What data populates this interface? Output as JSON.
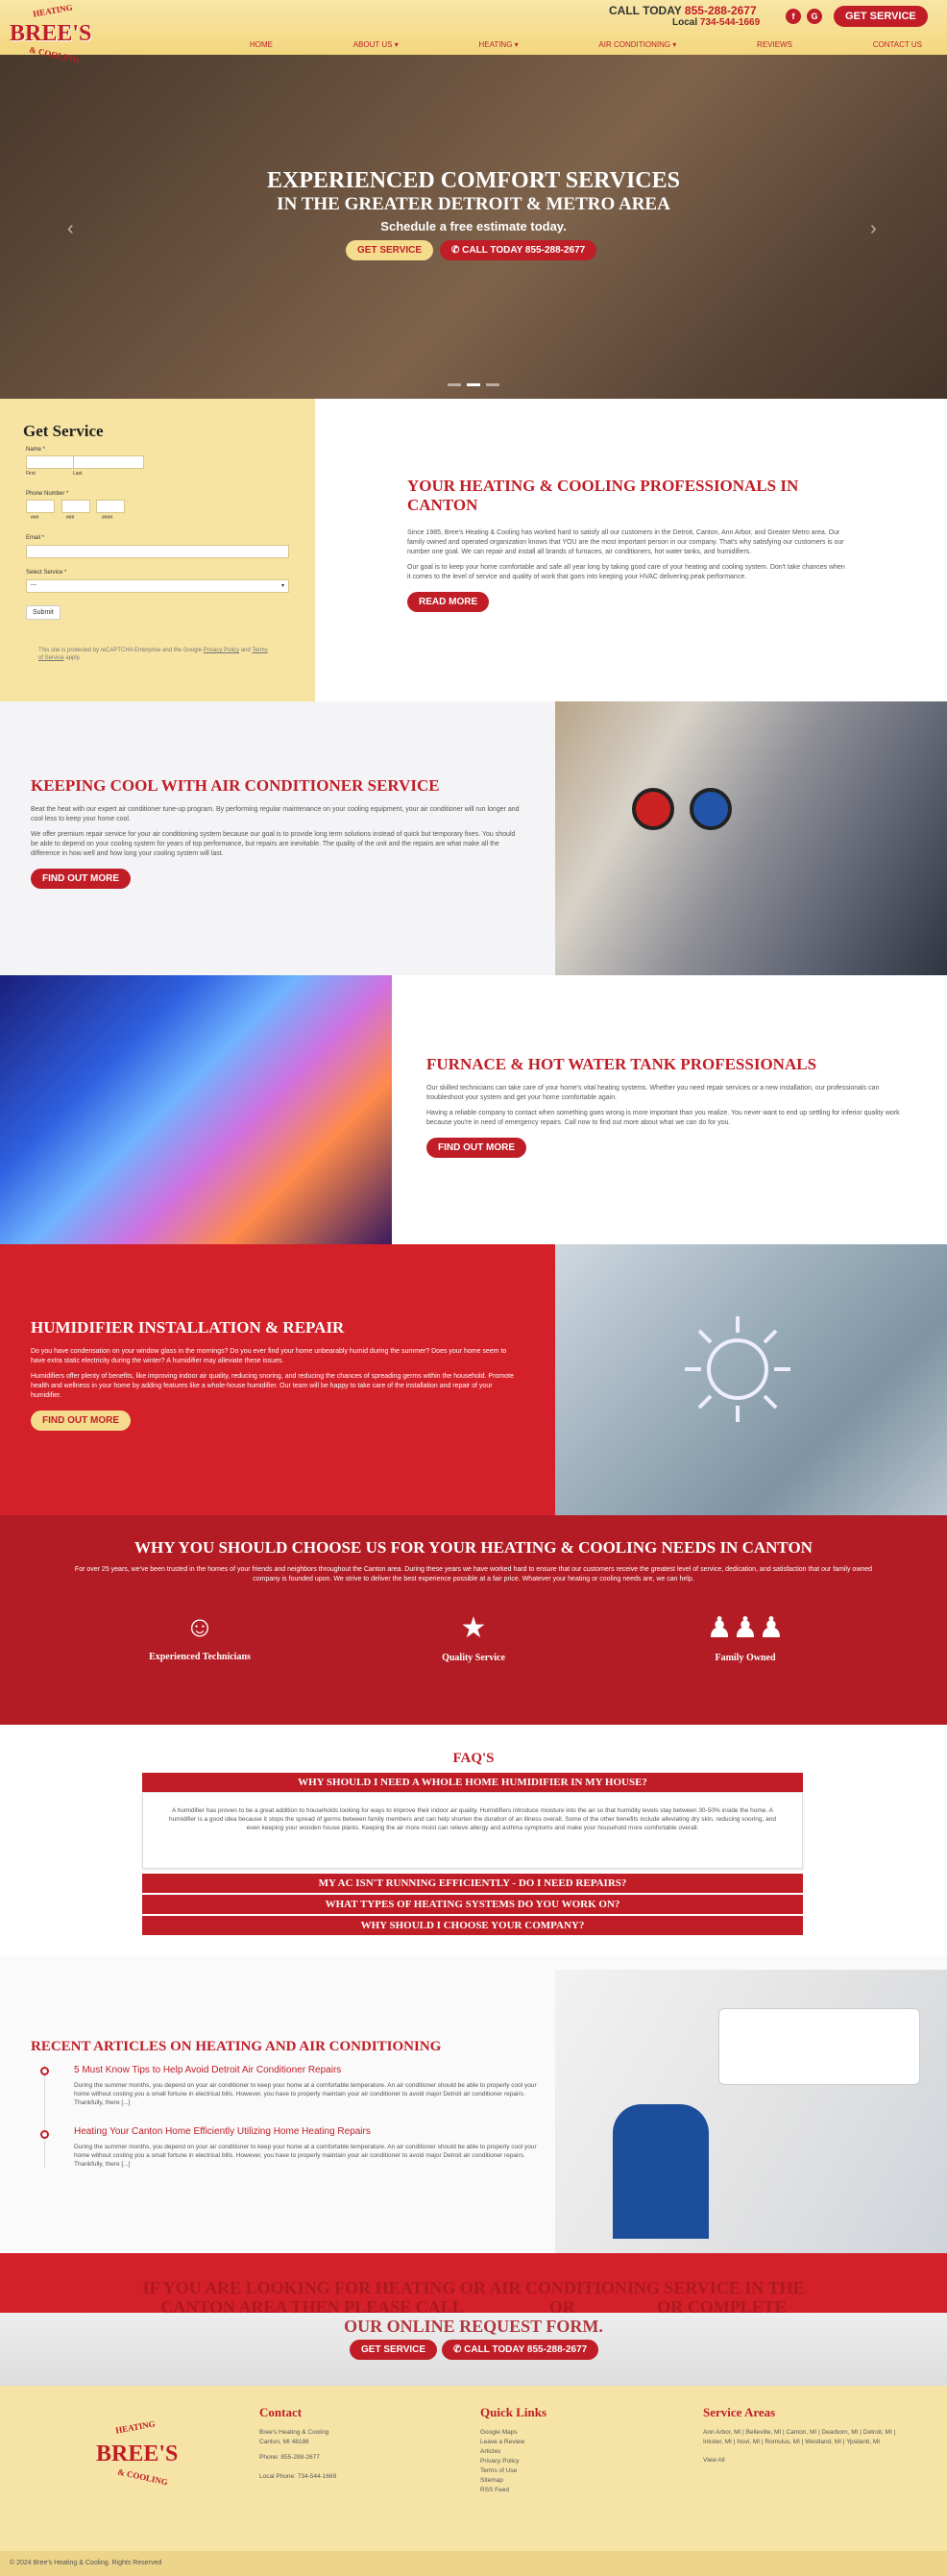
{
  "header": {
    "logo_top": "HEATING",
    "logo_main": "BREE'S",
    "logo_bottom": "& COOLING",
    "phone_label": "CALL TODAY",
    "phone_number": "855-288-2677",
    "local_label": "Local",
    "local_number": "734-544-1669",
    "social": [
      "f",
      "G"
    ],
    "cta": "GET SERVICE",
    "nav": [
      "HOME",
      "ABOUT US ▾",
      "HEATING ▾",
      "AIR CONDITIONING ▾",
      "REVIEWS",
      "CONTACT US"
    ]
  },
  "hero": {
    "line1": "EXPERIENCED COMFORT SERVICES",
    "line2": "IN THE GREATER DETROIT & METRO AREA",
    "sub": "Schedule a free estimate today.",
    "btn1": "GET SERVICE",
    "btn2": "CALL TODAY 855-288-2677",
    "prev": "‹",
    "next": "›"
  },
  "form": {
    "title": "Get Service",
    "name_label": "Name *",
    "first": "First",
    "last": "Last",
    "phone_label": "Phone Number *",
    "p1": "###",
    "p2": "###",
    "p3": "####",
    "email_label": "Email *",
    "select_label": "Select Service *",
    "select_value": "---",
    "submit": "Submit",
    "recaptcha1": "This site is protected by reCAPTCHA Enterprise and the Google",
    "privacy": "Privacy Policy",
    "and": "and",
    "terms": "Terms of Service",
    "apply": "apply."
  },
  "intro": {
    "title": "YOUR HEATING & COOLING PROFESSIONALS IN CANTON",
    "p1": "Since 1985, Bree's Heating & Cooling has worked hard to satisfy all our customers in the Detroit, Canton, Ann Arbor, and Greater Metro area. Our family owned and operated organization knows that YOU are the most important person in our company. That's why satisfying our customers is our number one goal. We can repair and install all brands of furnaces, air conditioners, hot water tanks, and humidifiers.",
    "p2": "Our goal is to keep your home comfortable and safe all year long by taking good care of your heating and cooling system. Don't take chances when it comes to the level of service and quality of work that goes into keeping your HVAC delivering peak performance.",
    "btn": "READ MORE"
  },
  "ac": {
    "title": "KEEPING COOL WITH AIR CONDITIONER SERVICE",
    "p1": "Beat the heat with our expert air conditioner tune-up program. By performing regular maintenance on your cooling equipment, your air conditioner will run longer and cool less to keep your home cool.",
    "p2": "We offer premium repair service for your air conditioning system because our goal is to provide long term solutions instead of quick but temporary fixes. You should be able to depend on your cooling system for years of top performance, but repairs are inevitable. The quality of the unit and the repairs are what make all the difference in how well and how long your cooling system will last.",
    "btn": "FIND OUT MORE"
  },
  "furnace": {
    "title": "FURNACE & HOT WATER TANK PROFESSIONALS",
    "p1": "Our skilled technicians can take care of your home's vital heating systems. Whether you need repair services or a new installation, our professionals can troubleshoot your system and get your home comfortable again.",
    "p2": "Having a reliable company to contact when something goes wrong is more important than you realize. You never want to end up settling for inferior quality work because you're in need of emergency repairs. Call now to find out more about what we can do for you.",
    "btn": "FIND OUT MORE"
  },
  "humid": {
    "title": "HUMIDIFIER INSTALLATION & REPAIR",
    "p1": "Do you have condensation on your window glass in the mornings? Do you ever find your home unbearably humid during the summer? Does your home seem to have extra static electricity during the winter? A humidifier may alleviate these issues.",
    "p2": "Humidifiers offer plenty of benefits, like improving indoor air quality, reducing snoring, and reducing the chances of spreading germs within the household. Promote health and wellness in your home by adding features like a whole-house humidifier. Our team will be happy to take care of the installation and repair of your humidifier.",
    "btn": "FIND OUT MORE"
  },
  "why": {
    "title": "WHY YOU SHOULD CHOOSE US FOR YOUR HEATING & COOLING NEEDS IN CANTON",
    "text": "For over 25 years, we've been trusted in the homes of your friends and neighbors throughout the Canton area. During these years we have worked hard to ensure that our customers receive the greatest level of service, dedication, and satisfaction that our family owned company is founded upon. We strive to deliver the best experience possible at a fair price. Whatever your heating or cooling needs are, we can help.",
    "items": [
      "Experienced Technicians",
      "Quality Service",
      "Family Owned"
    ]
  },
  "faq": {
    "title": "FAQ'S",
    "q1": "WHY SHOULD I NEED A WHOLE HOME HUMIDIFIER IN MY HOUSE?",
    "a1": "A humidifier has proven to be a great addition to households looking for ways to improve their indoor air quality. Humidifiers introduce moisture into the air so that humidity levels stay between 30-50% inside the home. A humidifier is a good idea because it stops the spread of germs between family members and can help shorten the duration of an illness overall. Some of the other benefits include alleviating dry skin, reducing snoring, and even keeping your wooden house plants. Keeping the air more moist can relieve allergy and asthma symptoms and make your household more comfortable overall.",
    "q2": "MY AC ISN'T RUNNING EFFICIENTLY - DO I NEED REPAIRS?",
    "q3": "WHAT TYPES OF HEATING SYSTEMS DO YOU WORK ON?",
    "q4": "WHY SHOULD I CHOOSE YOUR COMPANY?"
  },
  "articles": {
    "title": "RECENT ARTICLES ON HEATING AND AIR CONDITIONING",
    "a1_title": "5 Must Know Tips to Help Avoid Detroit Air Conditioner Repairs",
    "a1_text": "During the summer months, you depend on your air conditioner to keep your home at a comfortable temperature. An air conditioner should be able to properly cool your home without costing you a small fortune in electrical bills. However, you have to properly maintain your air conditioner to avoid major Detroit air conditioner repairs. Thankfully, there [...]",
    "a2_title": "Heating Your Canton Home Efficiently Utilizing Home Heating Repairs",
    "a2_text": "During the summer months, you depend on your air conditioner to keep your home at a comfortable temperature. An air conditioner should be able to properly cool your home without costing you a small fortune in electrical bills. However, you have to properly maintain your air conditioner to avoid major Detroit air conditioner repairs. Thankfully, there [...]"
  },
  "cta": {
    "line1": "IF YOU ARE LOOKING FOR HEATING OR AIR CONDITIONING SERVICE IN THE",
    "line2": "CANTON AREA THEN PLEASE CALL                    OR                   OR COMPLETE",
    "line3": "OUR ONLINE REQUEST FORM.",
    "btn1": "GET SERVICE",
    "btn2": "CALL TODAY 855-288-2677"
  },
  "footer": {
    "contact_title": "Contact",
    "contact_lines": [
      "Bree's Heating & Cooling",
      "Canton, MI 48188"
    ],
    "phone": "Phone: 855-288-2677",
    "local": "Local Phone: 734-544-1669",
    "quick_title": "Quick Links",
    "quick": [
      "Google Maps",
      "Leave a Review",
      "Articles",
      "Privacy Policy",
      "Terms of Use",
      "Sitemap",
      "RSS Feed"
    ],
    "areas_title": "Service Areas",
    "areas": "Ann Arbor, MI | Belleville, MI | Canton, MI | Dearborn, MI | Detroit, MI | Inkster, MI | Novi, MI | Romulus, MI | Westland, MI | Ypsilanti, MI",
    "view_all": "View All",
    "copyright": "© 2024 Bree's Heating & Cooling. Rights Reserved"
  }
}
